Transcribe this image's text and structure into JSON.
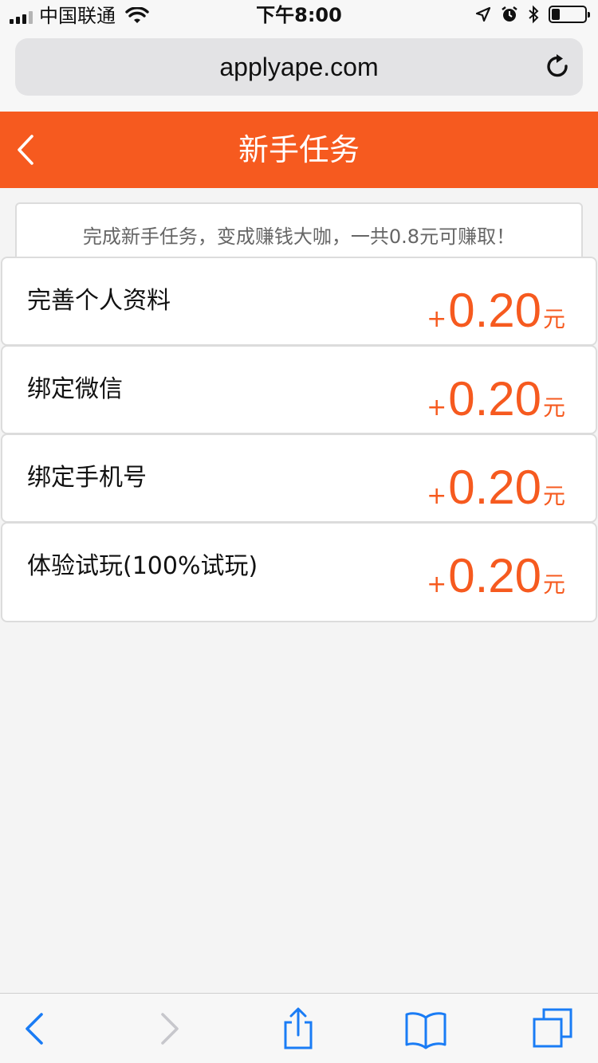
{
  "status_bar": {
    "carrier": "中国联通",
    "time": "下午8:00"
  },
  "browser": {
    "url": "applyape.com"
  },
  "header": {
    "title": "新手任务"
  },
  "notice": {
    "text": "完成新手任务，变成赚钱大咖，一共0.8元可赚取！"
  },
  "tasks": [
    {
      "label": "完善个人资料",
      "plus": "+",
      "amount": "0.20",
      "unit": "元"
    },
    {
      "label": "绑定微信",
      "plus": "+",
      "amount": "0.20",
      "unit": "元"
    },
    {
      "label": "绑定手机号",
      "plus": "+",
      "amount": "0.20",
      "unit": "元"
    },
    {
      "label": "体验试玩(100%试玩)",
      "plus": "+",
      "amount": "0.20",
      "unit": "元"
    }
  ],
  "colors": {
    "accent": "#f65a1f",
    "ios_blue": "#1a7cf5"
  },
  "icons": {
    "back": "chevron-left-icon",
    "forward": "chevron-right-icon",
    "share": "share-icon",
    "bookmarks": "book-icon",
    "tabs": "tabs-icon",
    "reload": "reload-icon"
  }
}
